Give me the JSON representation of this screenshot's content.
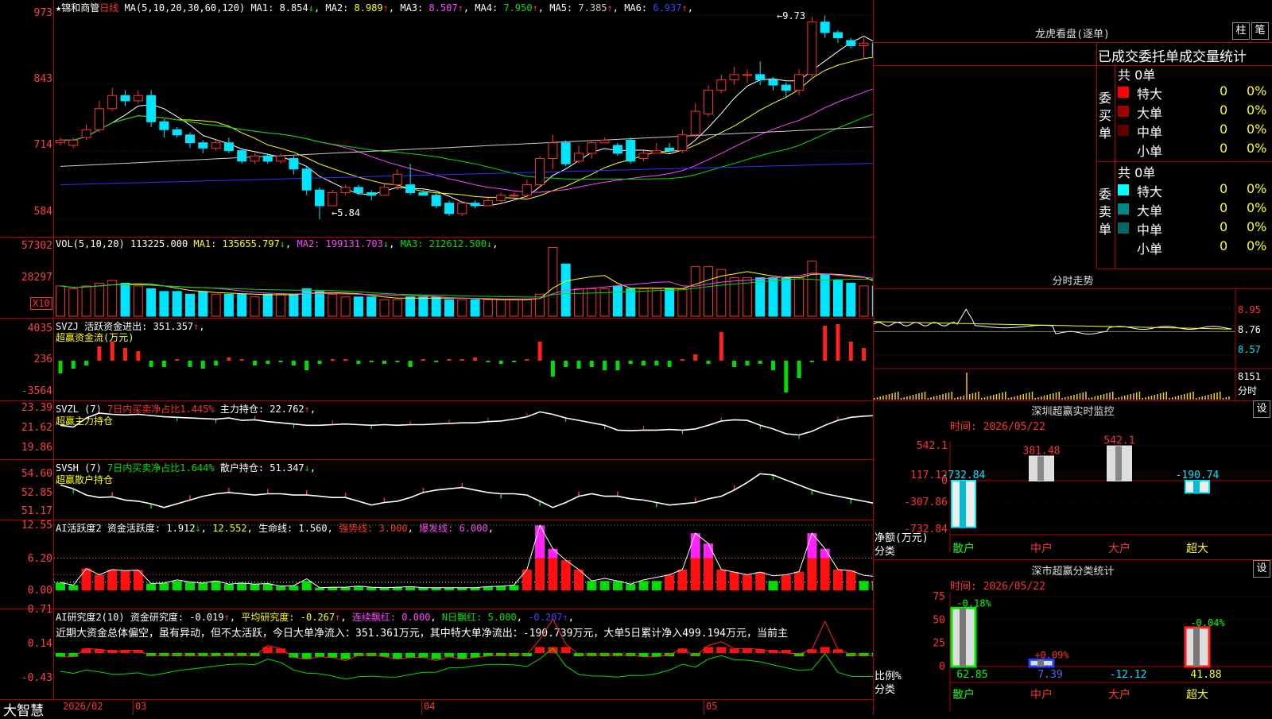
{
  "stock": {
    "name": "锦和商管",
    "period": "日线"
  },
  "price_pane": {
    "ma_legend": "MA(5,10,20,30,60,120)",
    "ma": [
      {
        "label": "MA1:",
        "value": "8.854",
        "arrow": "↓",
        "color": "#ffffff"
      },
      {
        "label": "MA2:",
        "value": "8.989",
        "arrow": "↑",
        "color": "#ffff00"
      },
      {
        "label": "MA3:",
        "value": "8.507",
        "arrow": "↑",
        "color": "#ff44ff"
      },
      {
        "label": "MA4:",
        "value": "7.950",
        "arrow": "↑",
        "color": "#00e000"
      },
      {
        "label": "MA5:",
        "value": "7.385",
        "arrow": "↑",
        "color": "#cccccc"
      },
      {
        "label": "MA6:",
        "value": "6.937",
        "arrow": "↑",
        "color": "#4040ff"
      }
    ],
    "yticks": [
      "973",
      "843",
      "714",
      "584"
    ],
    "high_note": "9.73",
    "low_note": "5.84"
  },
  "vol_pane": {
    "legend_label": "VOL(5,10,20)",
    "value": "113225.000",
    "ma": [
      {
        "label": "MA1:",
        "value": "135655.797",
        "arrow": "↓"
      },
      {
        "label": "MA2:",
        "value": "199131.703",
        "arrow": "↓"
      },
      {
        "label": "MA3:",
        "value": "212612.500",
        "arrow": "↓"
      }
    ],
    "yticks": [
      "57302",
      "28297"
    ],
    "unit": "X10"
  },
  "svzj_pane": {
    "line1": "SVZJ  活跃资金进出: 351.357",
    "line1_arrow": "↑",
    "line2": "超赢资金流(万元)",
    "yticks": [
      "4035",
      "236",
      "-3564"
    ]
  },
  "svzl_pane": {
    "prefix": "SVZL (7)",
    "pct": "7日内买卖净占比1.445%",
    "hold": "主力持仓: 22.762",
    "arrow": "↑",
    "line2": "超赢主力持仓",
    "yticks": [
      "23.39",
      "21.62",
      "19.86"
    ]
  },
  "svsh_pane": {
    "prefix": "SVSH (7)",
    "pct": "7日内买卖净占比1.644%",
    "hold": "散户持仓: 51.347",
    "arrow": "↓",
    "line2": "超赢散户持仓",
    "yticks": [
      "54.60",
      "52.85",
      "51.17"
    ]
  },
  "ai2_pane": {
    "name": "AI活跃度2",
    "a": "资金活跃度: 1.912",
    "a_arrow": "↓",
    "b": "12.552",
    "c": "生命线: 1.560",
    "d": "强势线: 3.000",
    "e": "爆发线: 6.000",
    "yticks": [
      "12.55",
      "6.20",
      "0.00"
    ]
  },
  "ai_research_pane": {
    "name": "AI研究度2(10)",
    "a": "资金研究度: -0.019",
    "b": "平均研究度: -0.267",
    "c": "连续飘红: 0.000",
    "d": "N日飘红: 5.000",
    "e": "-0.207",
    "note": "近期大资金总体偏空，虽有异动，但不太活跃，今日大单净流入：351.361万元，其中特大单净流出：-190.739万元，大单5日累计净入499.194万元，当前主",
    "yticks": [
      "0.71",
      "0.14",
      "-0.43"
    ]
  },
  "time_axis": {
    "brand": "大智慧",
    "labels": [
      "2026/02",
      "03",
      "04",
      "05"
    ]
  },
  "right": {
    "dragon_title": "龙虎看盘(逐单)",
    "btn1": "柱",
    "btn2": "笔",
    "tabs": "已成交委托单成交量统计",
    "buy_section": {
      "side_label": "委买单",
      "total": "共 0单",
      "rows": [
        {
          "name": "特大",
          "count": "0",
          "pct": "0%",
          "color": "#ff0000"
        },
        {
          "name": "大单",
          "count": "0",
          "pct": "0%",
          "color": "#a00000"
        },
        {
          "name": "中单",
          "count": "0",
          "pct": "0%",
          "color": "#600000"
        },
        {
          "name": "小单",
          "count": "0",
          "pct": "0%",
          "color": ""
        }
      ]
    },
    "sell_section": {
      "side_label": "委卖单",
      "total": "共 0单",
      "rows": [
        {
          "name": "特大",
          "count": "0",
          "pct": "0%",
          "color": "#00ffff"
        },
        {
          "name": "大单",
          "count": "0",
          "pct": "0%",
          "color": "#008888"
        },
        {
          "name": "中单",
          "count": "0",
          "pct": "0%",
          "color": "#006666"
        },
        {
          "name": "小单",
          "count": "0",
          "pct": "0%",
          "color": ""
        }
      ]
    },
    "intraday": {
      "title": "分时走势",
      "yticks": [
        "8.95",
        "8.76",
        "8.57"
      ],
      "vol": "8151",
      "vol_unit": "分时"
    },
    "monitor": {
      "title": "深圳超赢实时监控",
      "gear": "设",
      "time": "时间: 2026/05/22",
      "yticks": [
        "542.1",
        "117.12",
        "0",
        "-307.86",
        "-732.84"
      ],
      "y_title": "净额(万元)",
      "x_title": "分类",
      "categories": [
        "散户",
        "中户",
        "大户",
        "超大"
      ],
      "values": [
        -732.84,
        381.48,
        542.1,
        -190.74
      ],
      "value_labels": [
        "-732.84",
        "381.48",
        "542.1",
        "-190.74"
      ]
    },
    "classify": {
      "title": "深市超赢分类统计",
      "gear": "设",
      "time": "时间: 2026/05/22",
      "yticks": [
        "75",
        "50",
        "25",
        "0"
      ],
      "y_title": "比例%",
      "x_title": "分类",
      "categories": [
        "散户",
        "中户",
        "大户",
        "超大"
      ],
      "values": [
        62.85,
        7.39,
        -12.12,
        41.88
      ],
      "value_labels": [
        "62.85",
        "7.39",
        "-12.12",
        "41.88"
      ],
      "change_labels": [
        "-0.18%",
        "+0.09%",
        "",
        "-0.04%"
      ]
    }
  },
  "chart_data": {
    "type": "candlestick",
    "title": "锦和商管 日线",
    "ylim": [
      5.6,
      9.9
    ],
    "x_labels": [
      "2026/02",
      "03",
      "04",
      "05"
    ],
    "candles": [
      [
        7.3,
        7.35,
        7.4,
        7.25
      ],
      [
        7.25,
        7.35,
        7.4,
        7.2
      ],
      [
        7.4,
        7.55,
        7.65,
        7.35
      ],
      [
        7.55,
        7.95,
        8.1,
        7.5
      ],
      [
        7.95,
        8.2,
        8.35,
        7.9
      ],
      [
        8.2,
        8.1,
        8.3,
        8.0
      ],
      [
        8.1,
        8.2,
        8.3,
        8.05
      ],
      [
        8.2,
        7.7,
        8.3,
        7.6
      ],
      [
        7.7,
        7.55,
        7.75,
        7.4
      ],
      [
        7.55,
        7.45,
        7.6,
        7.4
      ],
      [
        7.45,
        7.3,
        7.5,
        7.2
      ],
      [
        7.3,
        7.2,
        7.35,
        7.1
      ],
      [
        7.2,
        7.3,
        7.35,
        7.15
      ],
      [
        7.3,
        7.15,
        7.4,
        7.1
      ],
      [
        7.15,
        6.95,
        7.2,
        6.9
      ],
      [
        6.95,
        7.05,
        7.1,
        6.9
      ],
      [
        7.05,
        6.95,
        7.1,
        6.9
      ],
      [
        6.95,
        7.05,
        7.1,
        6.9
      ],
      [
        7.0,
        6.8,
        7.05,
        6.7
      ],
      [
        6.8,
        6.4,
        6.85,
        6.3
      ],
      [
        6.4,
        6.1,
        6.45,
        5.84
      ],
      [
        6.1,
        6.35,
        6.4,
        6.1
      ],
      [
        6.35,
        6.45,
        6.5,
        6.3
      ],
      [
        6.45,
        6.35,
        6.5,
        6.3
      ],
      [
        6.35,
        6.3,
        6.4,
        6.2
      ],
      [
        6.3,
        6.45,
        6.5,
        6.3
      ],
      [
        6.5,
        6.7,
        6.8,
        6.4
      ],
      [
        6.5,
        6.35,
        6.9,
        6.3
      ],
      [
        6.35,
        6.3,
        6.4,
        6.3
      ],
      [
        6.3,
        6.1,
        6.35,
        6.05
      ],
      [
        6.15,
        5.95,
        6.2,
        5.9
      ],
      [
        5.95,
        6.15,
        6.2,
        5.9
      ],
      [
        6.15,
        6.1,
        6.2,
        6.05
      ],
      [
        6.1,
        6.2,
        6.25,
        6.1
      ],
      [
        6.2,
        6.3,
        6.35,
        6.15
      ],
      [
        6.3,
        6.3,
        6.35,
        6.25
      ],
      [
        6.3,
        6.5,
        6.6,
        6.25
      ],
      [
        6.5,
        7.0,
        7.05,
        6.45
      ],
      [
        7.0,
        7.3,
        7.45,
        6.8
      ],
      [
        7.3,
        6.9,
        7.35,
        6.85
      ],
      [
        6.95,
        7.1,
        7.25,
        6.9
      ],
      [
        7.1,
        7.3,
        7.35,
        7.0
      ],
      [
        7.3,
        7.35,
        7.4,
        7.3
      ],
      [
        7.25,
        7.1,
        7.3,
        7.05
      ],
      [
        7.35,
        6.95,
        7.4,
        6.9
      ],
      [
        7.0,
        7.1,
        7.15,
        6.95
      ],
      [
        7.1,
        7.15,
        7.3,
        7.1
      ],
      [
        7.2,
        7.15,
        7.3,
        7.1
      ],
      [
        7.15,
        7.45,
        7.55,
        7.1
      ],
      [
        7.45,
        7.9,
        8.05,
        7.4
      ],
      [
        7.85,
        8.3,
        8.4,
        7.8
      ],
      [
        8.3,
        8.5,
        8.6,
        8.25
      ],
      [
        8.5,
        8.6,
        8.75,
        8.4
      ],
      [
        8.6,
        8.6,
        8.7,
        8.45
      ],
      [
        8.6,
        8.5,
        8.85,
        8.4
      ],
      [
        8.5,
        8.4,
        8.55,
        8.3
      ],
      [
        8.4,
        8.3,
        8.45,
        8.15
      ],
      [
        8.3,
        8.6,
        8.7,
        8.2
      ],
      [
        8.6,
        9.6,
        9.7,
        8.55
      ],
      [
        9.6,
        9.4,
        9.73,
        9.3
      ],
      [
        9.4,
        9.3,
        9.45,
        9.2
      ],
      [
        9.25,
        9.15,
        9.3,
        9.1
      ],
      [
        9.15,
        9.2,
        9.3,
        8.9
      ],
      [
        9.2,
        8.95,
        9.25,
        8.9
      ],
      [
        8.95,
        9.1,
        9.3,
        8.8
      ],
      [
        9.1,
        8.95,
        9.4,
        8.85
      ],
      [
        8.95,
        9.05,
        9.3,
        8.85
      ]
    ],
    "volume": [
      11,
      10,
      11,
      12,
      13,
      12,
      11,
      10,
      9,
      9,
      8,
      9,
      8,
      8,
      8,
      7,
      8,
      8,
      8,
      10,
      9,
      8,
      7,
      7,
      7,
      6,
      6,
      7,
      7,
      7,
      6,
      6,
      6,
      6,
      6,
      6,
      6,
      8,
      25,
      19,
      10,
      10,
      10,
      11,
      10,
      10,
      10,
      10,
      10,
      18,
      18,
      17,
      14,
      14,
      14,
      14,
      14,
      14,
      20,
      15,
      13,
      12,
      11,
      11,
      10,
      10,
      9
    ],
    "fund_flow": [
      -8,
      -5,
      -3,
      9,
      12,
      8,
      6,
      -4,
      -4,
      1,
      -4,
      -5,
      -3,
      2,
      1,
      -3,
      -2,
      -1,
      -3,
      -6,
      -2,
      1,
      1,
      -2,
      -1,
      -2,
      -1,
      -4,
      1,
      -1,
      1,
      1,
      2,
      -1,
      -2,
      -1,
      1,
      12,
      -10,
      -4,
      -5,
      -4,
      -6,
      -6,
      -2,
      -3,
      -3,
      -4,
      1,
      4,
      -2,
      18,
      -4,
      -3,
      -2,
      -6,
      -20,
      -11,
      -1,
      22,
      23,
      12,
      8,
      6,
      5,
      -4,
      8,
      -7,
      4
    ],
    "svzl": [
      22.0,
      21.85,
      22.6,
      23.0,
      22.9,
      22.85,
      22.9,
      22.8,
      22.7,
      22.65,
      22.6,
      22.55,
      22.5,
      22.6,
      22.4,
      22.45,
      22.3,
      22.2,
      22.1,
      22.0,
      22.0,
      22.05,
      22.1,
      22.05,
      22.0,
      22.05,
      22.0,
      22.05,
      22.05,
      22.1,
      22.15,
      22.2,
      22.2,
      22.3,
      22.35,
      22.5,
      22.7,
      23.1,
      22.9,
      22.6,
      22.4,
      22.2,
      22.0,
      21.6,
      21.55,
      21.6,
      21.6,
      21.65,
      21.6,
      21.7,
      22.0,
      22.35,
      22.45,
      22.4,
      22.0,
      21.7,
      21.3,
      21.2,
      21.5,
      22.0,
      22.4,
      22.65,
      22.75,
      22.8,
      22.85,
      22.85,
      22.8,
      22.8,
      22.85,
      22.75
    ],
    "svsh": [
      53.3,
      53.0,
      52.5,
      52.3,
      52.35,
      52.1,
      52.0,
      51.8,
      51.5,
      51.8,
      52.1,
      52.4,
      52.6,
      52.7,
      52.6,
      52.5,
      52.6,
      52.6,
      52.5,
      52.5,
      52.4,
      52.3,
      52.3,
      52.0,
      51.7,
      51.9,
      52.0,
      52.3,
      52.7,
      52.9,
      53.0,
      53.1,
      52.9,
      52.7,
      52.6,
      52.6,
      52.5,
      52.0,
      51.5,
      51.9,
      52.4,
      52.6,
      52.4,
      52.4,
      52.2,
      52.1,
      51.9,
      51.7,
      51.8,
      51.9,
      52.2,
      52.4,
      52.9,
      53.5,
      54.2,
      54.1,
      53.7,
      53.3,
      52.9,
      52.6,
      52.4,
      52.2,
      52.0,
      51.8,
      51.7,
      51.6,
      51.5,
      51.4,
      51.3
    ],
    "ai2": [
      1.5,
      1.0,
      4.2,
      3.0,
      4.0,
      3.8,
      3.9,
      1.3,
      1.4,
      2.0,
      1.6,
      1.4,
      1.8,
      1.2,
      1.4,
      1.2,
      1.3,
      0.8,
      0.9,
      2.2,
      0.5,
      0.6,
      0.6,
      0.8,
      0.6,
      0.5,
      0.6,
      0.7,
      0.5,
      0.5,
      0.5,
      0.5,
      0.5,
      0.7,
      0.8,
      1.0,
      4.0,
      12.5,
      8.0,
      5.8,
      4.0,
      1.8,
      2.3,
      1.8,
      1.2,
      2.0,
      2.5,
      3.0,
      4.0,
      11.0,
      9.0,
      4.0,
      3.5,
      3.0,
      3.5,
      2.8,
      3.0,
      3.6,
      11.0,
      8.0,
      4.0,
      3.8,
      2.9,
      2.6,
      2.8,
      3.0,
      2.8,
      2.4,
      1.9
    ],
    "ai_research": [
      -0.05,
      -0.05,
      0.06,
      0.05,
      0.02,
      0.03,
      0.04,
      -0.04,
      -0.03,
      -0.02,
      -0.03,
      -0.04,
      -0.04,
      -0.03,
      -0.03,
      -0.04,
      0.1,
      0.06,
      -0.06,
      -0.08,
      -0.05,
      -0.06,
      -0.1,
      -0.03,
      -0.02,
      -0.05,
      -0.08,
      -0.06,
      -0.06,
      -0.1,
      -0.05,
      -0.08,
      -0.06,
      -0.04,
      -0.03,
      -0.02,
      -0.02,
      0.18,
      0.45,
      0.12,
      -0.02,
      -0.03,
      -0.02,
      -0.04,
      -0.02,
      -0.05,
      -0.05,
      -0.02,
      0.06,
      -0.04,
      0.1,
      0.15,
      0.06,
      0.06,
      0.05,
      0.02,
      0.0,
      -0.01,
      0.05,
      0.42,
      0.05,
      -0.02,
      -0.03,
      -0.04,
      -0.03,
      -0.05,
      -0.06,
      -0.04,
      -0.05,
      -0.02
    ]
  }
}
